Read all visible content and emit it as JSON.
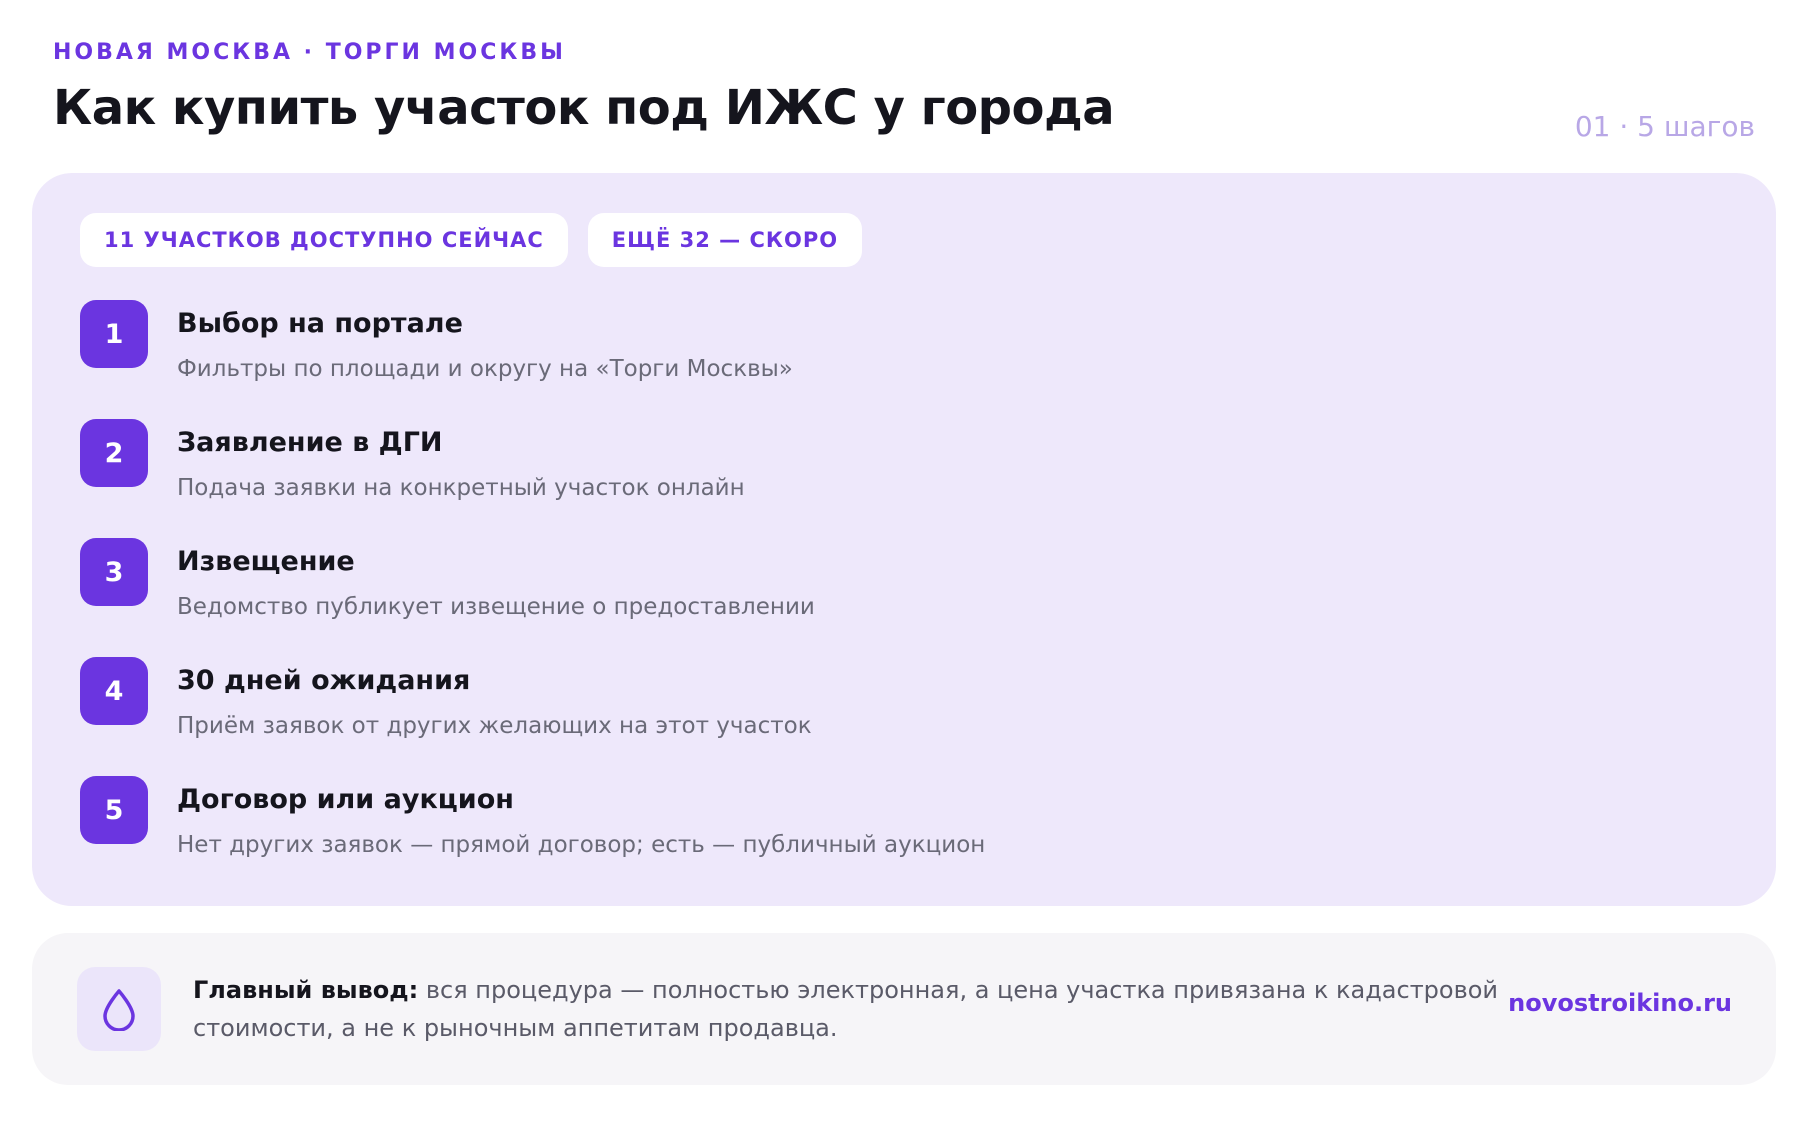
{
  "header": {
    "eyebrow": "НОВАЯ МОСКВА · ТОРГИ МОСКВЫ",
    "title": "Как купить участок под ИЖС у города",
    "counter": "01 · 5 шагов"
  },
  "chips": [
    "11 УЧАСТКОВ ДОСТУПНО СЕЙЧАС",
    "ЕЩЁ 32 — СКОРО"
  ],
  "steps": [
    {
      "num": "1",
      "title": "Выбор на портале",
      "desc": "Фильтры по площади и округу на «Торги Москвы»"
    },
    {
      "num": "2",
      "title": "Заявление в ДГИ",
      "desc": "Подача заявки на конкретный участок онлайн"
    },
    {
      "num": "3",
      "title": "Извещение",
      "desc": "Ведомство публикует извещение о предоставлении"
    },
    {
      "num": "4",
      "title": "30 дней ожидания",
      "desc": "Приём заявок от других желающих на этот участок"
    },
    {
      "num": "5",
      "title": "Договор или аукцион",
      "desc": "Нет других заявок — прямой договор; есть — публичный аукцион"
    }
  ],
  "summary": {
    "lead": "Главный вывод:",
    "text": " вся процедура — полностью электронная, а цена участка привязана к кадастровой стоимости, а не к рыночным аппетитам продавца.",
    "icon": "drop-icon",
    "site": "novostroikino.ru"
  },
  "colors": {
    "accent": "#6b35e0",
    "card_bg": "#eee8fb",
    "summary_bg": "#f6f5f8",
    "counter": "#b8a7e6"
  }
}
